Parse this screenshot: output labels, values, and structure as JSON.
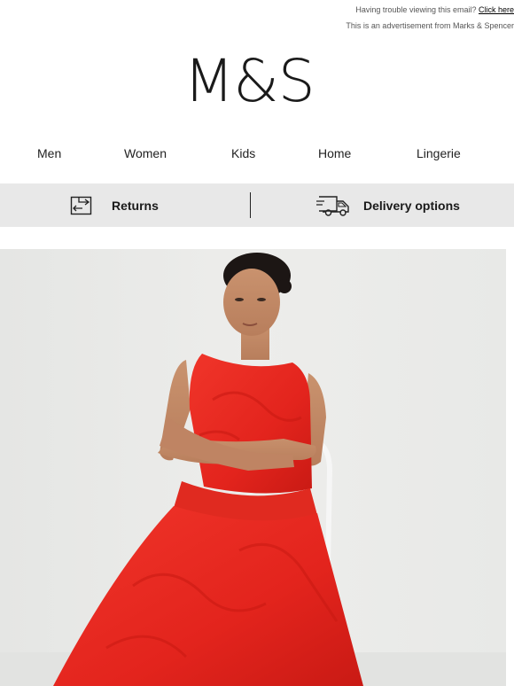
{
  "preheader": {
    "trouble_text": "Having trouble viewing this email? ",
    "click_here": "Click here",
    "advert_text": "This is an advertisement from Marks & Spencer"
  },
  "brand": {
    "logo_text": "M&S"
  },
  "nav": {
    "items": [
      {
        "label": "Men"
      },
      {
        "label": "Women"
      },
      {
        "label": "Kids"
      },
      {
        "label": "Home"
      },
      {
        "label": "Lingerie"
      }
    ]
  },
  "service_bar": {
    "returns_label": "Returns",
    "returns_icon": "returns-box-icon",
    "delivery_label": "Delivery options",
    "delivery_icon": "delivery-truck-icon"
  },
  "hero": {
    "image": "woman-in-red-dress-photo",
    "dress_color": "#e8271f",
    "background_color": "#e9eae8"
  }
}
